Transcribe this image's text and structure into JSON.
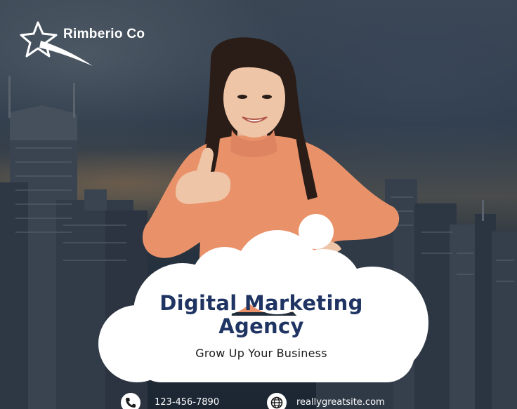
{
  "brand": {
    "name": "Rimberio Co",
    "logo_icon": "star-swoosh-icon"
  },
  "headline": {
    "line1": "Digital Marketing",
    "line2": "Agency"
  },
  "tagline": "Grow Up Your Business",
  "contact": {
    "phone": {
      "icon": "phone-icon",
      "text": "123-456-7890"
    },
    "website": {
      "icon": "globe-icon",
      "text": "reallygreatsite.com"
    }
  },
  "colors": {
    "headline": "#1f3462",
    "cloud": "#ffffff",
    "sweater": "#e9926a",
    "sky_dark": "#1f2b3a"
  }
}
